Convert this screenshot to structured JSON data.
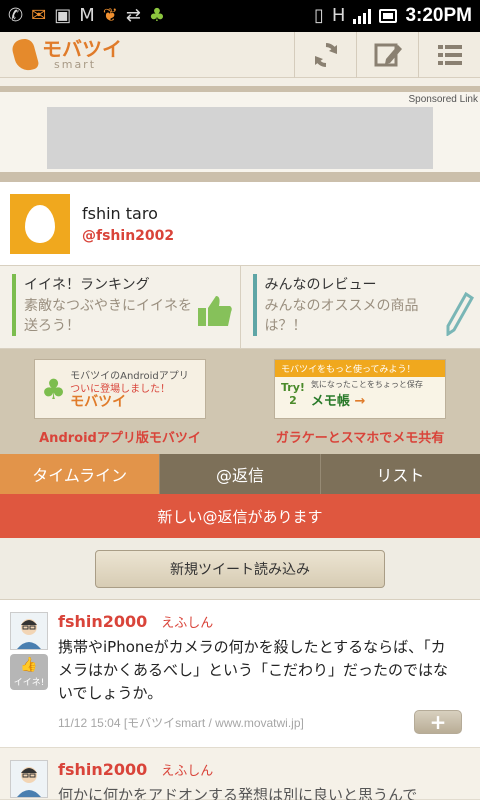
{
  "status_bar": {
    "time": "3:20PM",
    "network": "H"
  },
  "app": {
    "logo_main": "モバツイ",
    "logo_sub": "smart"
  },
  "ad": {
    "sponsored": "Sponsored Link"
  },
  "profile": {
    "name": "fshin taro",
    "handle": "@fshin2002"
  },
  "promos": [
    {
      "title": "イイネ！ランキング",
      "desc": "素敵なつぶやきにイイネを送ろう！",
      "bar_color": "#7cbd4e"
    },
    {
      "title": "みんなのレビュー",
      "desc": "みんなのオススメの商品は？！",
      "bar_color": "#5fa6a6"
    }
  ],
  "banners": [
    {
      "caption": "Androidアプリ版モバツイ",
      "img_line1": "モバツイのAndroidアプリ",
      "img_line2": "ついに登場しました！",
      "img_brand": "モバツイ"
    },
    {
      "caption": "ガラケーとスマホでメモ共有",
      "img_top": "モバツイをもっと使ってみよう！",
      "img_try": "Try!",
      "img_num": "2",
      "img_desc": "気になったことをちょっと保存",
      "img_memo": "メモ帳"
    }
  ],
  "tabs": [
    {
      "label": "タイムライン",
      "active": true
    },
    {
      "label": "@返信",
      "active": false
    },
    {
      "label": "リスト",
      "active": false
    }
  ],
  "notice": "新しい@返信があります",
  "load_button": "新規ツイート読み込み",
  "tweets": [
    {
      "user": "fshin2000",
      "name": "えふしん",
      "like_label": "イイネ!",
      "text": "携帯やiPhoneがカメラの何かを殺したとするならば、「カメラはかくあるべし」という「こだわり」だったのではないでしょうか。",
      "meta": "11/12 15:04 [モバツイsmart / www.movatwi.jp]",
      "plus": "+"
    },
    {
      "user": "fshin2000",
      "name": "えふしん",
      "text": "何かに何かをアドオンする発想は別に良いと思うんで"
    }
  ],
  "icons": {
    "status_left": [
      "missed-call-icon",
      "gmail-icon",
      "twitter-icon",
      "shopping-icon",
      "usb-icon",
      "android-debug-icon"
    ],
    "header": [
      "refresh-icon",
      "compose-icon",
      "menu-icon"
    ]
  }
}
